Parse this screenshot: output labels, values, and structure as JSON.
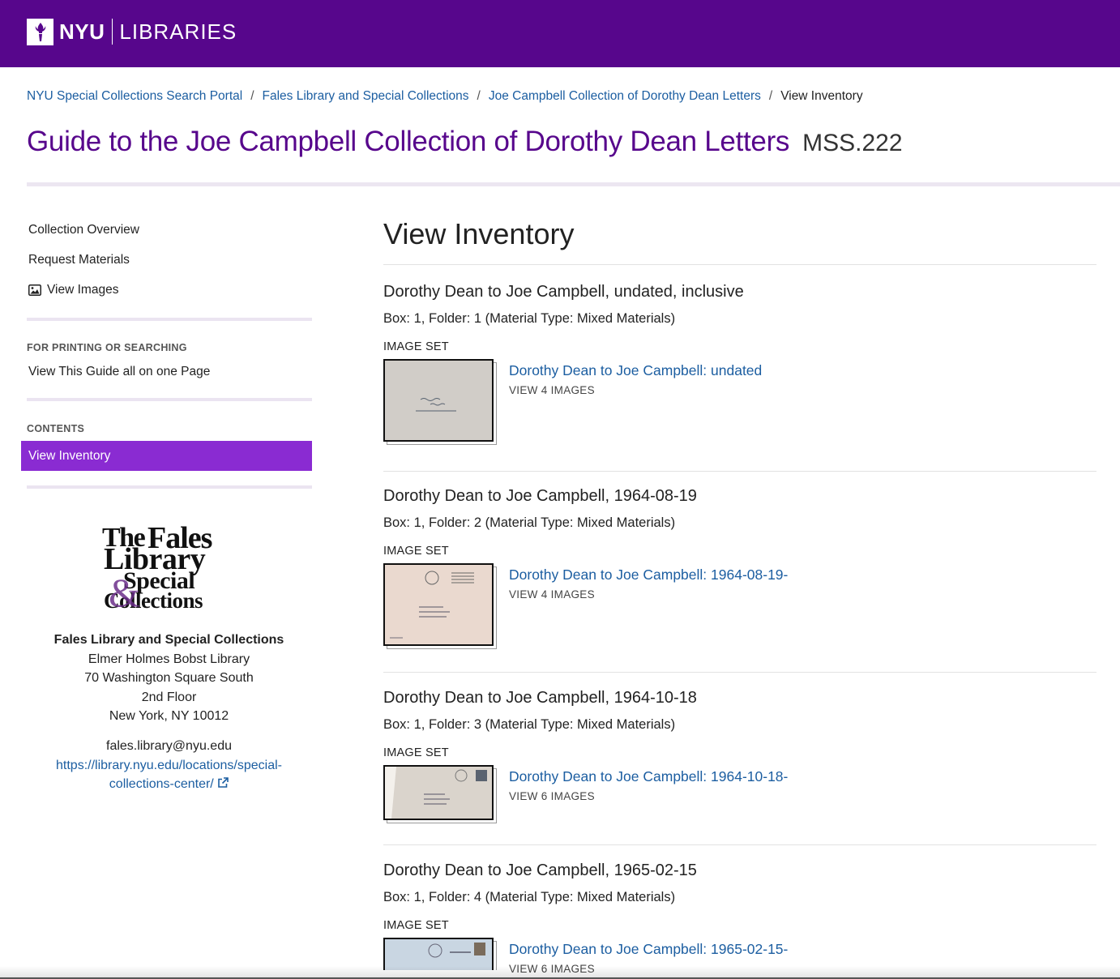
{
  "header": {
    "logo_nyu": "NYU",
    "logo_libraries": "LIBRARIES",
    "bar_color": "#57068c"
  },
  "breadcrumb": [
    {
      "label": "NYU Special Collections Search Portal"
    },
    {
      "label": "Fales Library and Special Collections"
    },
    {
      "label": "Joe Campbell Collection of Dorothy Dean Letters"
    },
    {
      "label": "View Inventory"
    }
  ],
  "page": {
    "title": "Guide to the Joe Campbell Collection of Dorothy Dean Letters",
    "id": "MSS.222"
  },
  "sidebar": {
    "links": [
      {
        "label": "Collection Overview"
      },
      {
        "label": "Request Materials"
      },
      {
        "label": "View Images",
        "icon": "image-icon"
      }
    ],
    "printing_heading": "FOR PRINTING OR SEARCHING",
    "printing_link": "View This Guide all on one Page",
    "contents_heading": "CONTENTS",
    "active_item": "View Inventory",
    "active_color": "#8a2bd2",
    "logo_text": {
      "line1_a": "The",
      "line1_b": "Fales",
      "line2": "Library",
      "line3_amp": "&",
      "line3": "Special",
      "line4": "Collections"
    },
    "address": {
      "name": "Fales Library and Special Collections",
      "line1": "Elmer Holmes Bobst Library",
      "line2": "70 Washington Square South",
      "line3": "2nd Floor",
      "line4": "New York, NY 10012",
      "email": "fales.library@nyu.edu",
      "url_part1": "https://library.nyu.edu/locations/special-",
      "url_part2": "collections-center/"
    }
  },
  "main": {
    "title": "View Inventory",
    "image_set_label": "IMAGE SET",
    "items": [
      {
        "title": "Dorothy Dean to Joe Campbell, undated, inclusive",
        "box": "Box: 1, Folder: 1 (Material Type: Mixed Materials)",
        "link": "Dorothy Dean to Joe Campbell: undated",
        "count": "VIEW 4 IMAGES"
      },
      {
        "title": "Dorothy Dean to Joe Campbell, 1964-08-19",
        "box": "Box: 1, Folder: 2 (Material Type: Mixed Materials)",
        "link": "Dorothy Dean to Joe Campbell: 1964-08-19-",
        "count": "VIEW 4 IMAGES"
      },
      {
        "title": "Dorothy Dean to Joe Campbell, 1964-10-18",
        "box": "Box: 1, Folder: 3 (Material Type: Mixed Materials)",
        "link": "Dorothy Dean to Joe Campbell: 1964-10-18-",
        "count": "VIEW 6 IMAGES"
      },
      {
        "title": "Dorothy Dean to Joe Campbell, 1965-02-15",
        "box": "Box: 1, Folder: 4 (Material Type: Mixed Materials)",
        "link": "Dorothy Dean to Joe Campbell: 1965-02-15-",
        "count": "VIEW 6 IMAGES"
      }
    ]
  }
}
